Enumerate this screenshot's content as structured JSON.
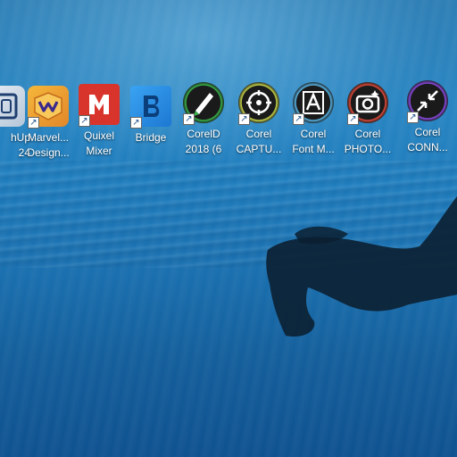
{
  "desktop": {
    "icons": [
      {
        "line1": "hUp",
        "line2": "24",
        "icon": "sketchup-icon"
      },
      {
        "line1": "Marvel...",
        "line2": "Design...",
        "icon": "marvelous-designer-icon"
      },
      {
        "line1": "Quixel",
        "line2": "Mixer",
        "icon": "quixel-mixer-icon"
      },
      {
        "line1": "Bridge",
        "line2": "",
        "icon": "bridge-icon"
      },
      {
        "line1": "CorelD",
        "line2": "2018 (6",
        "icon": "coreldraw-icon"
      },
      {
        "line1": "Corel",
        "line2": "CAPTU...",
        "icon": "corel-capture-icon"
      },
      {
        "line1": "Corel",
        "line2": "Font M...",
        "icon": "corel-font-manager-icon"
      },
      {
        "line1": "Corel",
        "line2": "PHOTO...",
        "icon": "corel-photo-paint-icon"
      },
      {
        "line1": "Corel",
        "line2": "CONN...",
        "icon": "corel-connect-icon"
      }
    ]
  }
}
